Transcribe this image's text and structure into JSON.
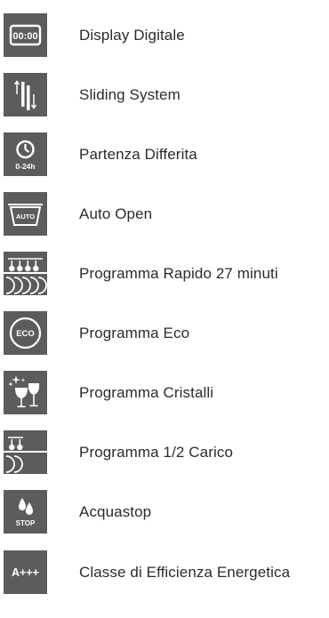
{
  "features": [
    {
      "icon": "digital-display-icon",
      "label": "Display Digitale",
      "icon_text": "00:00"
    },
    {
      "icon": "sliding-system-icon",
      "label": "Sliding System"
    },
    {
      "icon": "delayed-start-icon",
      "label": "Partenza Differita",
      "icon_text": "0-24h"
    },
    {
      "icon": "auto-open-icon",
      "label": "Auto Open",
      "icon_text": "AUTO"
    },
    {
      "icon": "rapid-program-icon",
      "label": "Programma Rapido 27 minuti"
    },
    {
      "icon": "eco-program-icon",
      "label": "Programma Eco",
      "icon_text": "ECO"
    },
    {
      "icon": "crystal-program-icon",
      "label": "Programma Cristalli"
    },
    {
      "icon": "half-load-program-icon",
      "label": "Programma 1/2 Carico"
    },
    {
      "icon": "aquastop-icon",
      "label": "Acquastop",
      "icon_text": "STOP"
    },
    {
      "icon": "energy-class-icon",
      "label": "Classe di Efficienza Energetica",
      "icon_text": "A+++"
    }
  ],
  "colors": {
    "icon_background": "#5c5c5c",
    "icon_foreground": "#ffffff",
    "label_text": "#2b2b2b"
  }
}
